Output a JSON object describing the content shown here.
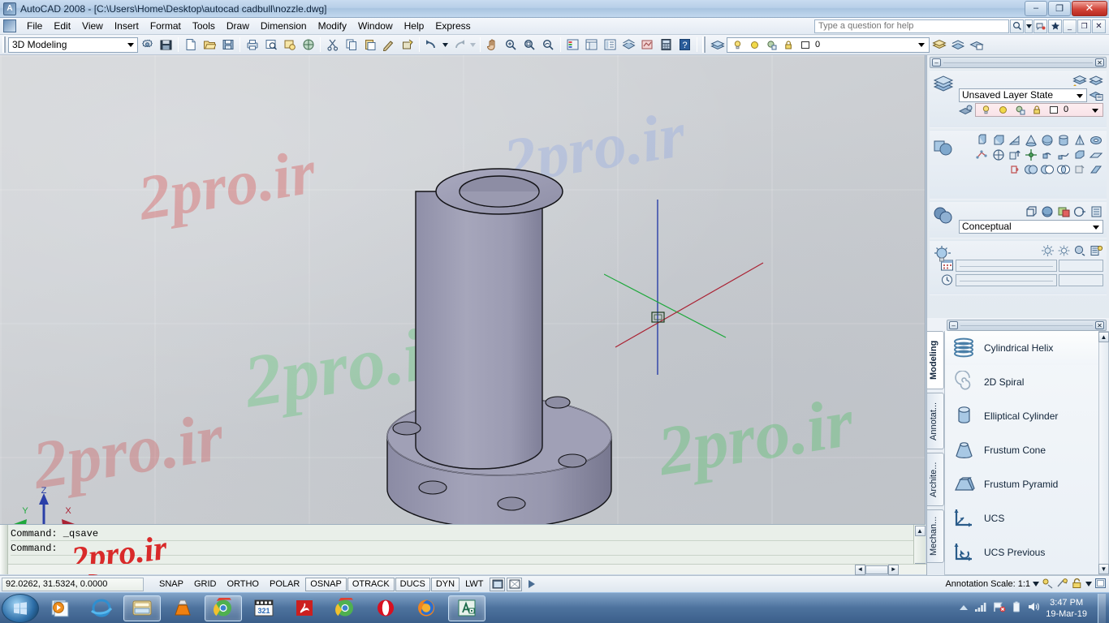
{
  "window": {
    "title": "AutoCAD 2008 - [C:\\Users\\Home\\Desktop\\autocad cadbull\\nozzle.dwg]",
    "icon": "autocad-icon",
    "minimize": "–",
    "maximize": "❐",
    "close": "✕"
  },
  "menubar": {
    "items": [
      {
        "label": "File"
      },
      {
        "label": "Edit"
      },
      {
        "label": "View"
      },
      {
        "label": "Insert"
      },
      {
        "label": "Format"
      },
      {
        "label": "Tools"
      },
      {
        "label": "Draw"
      },
      {
        "label": "Dimension"
      },
      {
        "label": "Modify"
      },
      {
        "label": "Window"
      },
      {
        "label": "Help"
      },
      {
        "label": "Express"
      }
    ],
    "help_placeholder": "Type a question for help",
    "search_icon": "magnifier-icon",
    "search_dropdown_icon": "chevron-down-icon",
    "comm_icon": "communication-center-icon",
    "fav_icon": "star-icon",
    "doc_minimize": "_",
    "doc_restore": "❐",
    "doc_close": "✕"
  },
  "toolbar": {
    "workspace": "3D Modeling",
    "workspace_settings_icon": "workspace-settings-icon",
    "workspace_save_icon": "workspace-save-icon",
    "layer_current": "0",
    "buttons": [
      "new-icon",
      "open-icon",
      "save-icon",
      "plot-icon",
      "plot-preview-icon",
      "publish-icon",
      "3dprint-icon",
      "cut-icon",
      "copy-icon",
      "paste-icon",
      "matchprop-icon",
      "blockeditor-icon",
      "undo-icon",
      "redo-icon",
      "pan-icon",
      "zoom-realtime-icon",
      "zoom-window-icon",
      "zoom-previous-icon",
      "properties-icon",
      "designcenter-icon",
      "toolpalettes-icon",
      "sheetset-icon",
      "markup-icon",
      "quickcalc-icon",
      "help-icon"
    ],
    "layer_icons": [
      "layers-icon",
      "lightbulb-icon",
      "sun-icon",
      "freeze-icon",
      "lock-icon",
      "color-swatch-icon"
    ],
    "layer_right_icons": [
      "layer-previous-icon",
      "layer-state-icon",
      "layer-properties-icon"
    ]
  },
  "canvas": {
    "ucs_labels": {
      "x": "X",
      "y": "Y",
      "z": "Z"
    },
    "model_name": "nozzle-3d-solid",
    "watermarks": [
      "2pro.ir",
      "2pro.ir",
      "2pro.ir",
      "2pro.ir",
      "2pro.ir"
    ]
  },
  "dashboard": {
    "panels": [
      {
        "name": "layers-panel",
        "big_icon": "layers-icon",
        "layer_state": "Unsaved Layer State",
        "layer_current": "0",
        "icons": [
          "layer-previous-icon",
          "layer-manager-icon",
          "layer-state-manager-icon",
          "layer-prop-icon",
          "lightbulb-icon",
          "sun-icon",
          "freeze-icon",
          "lock-icon",
          "color-swatch-icon"
        ]
      },
      {
        "name": "3d-make-panel",
        "big_icon": "3d-make-icon",
        "icons": [
          "box-icon",
          "wedge-icon",
          "pyramid-icon",
          "cone-icon",
          "sphere-icon",
          "cylinder-icon",
          "torus-icon",
          "polysolid-icon",
          "helix-icon",
          "extrude-icon",
          "revolve-icon",
          "sweep-icon",
          "loft-icon",
          "presspull-icon",
          "planarsurf-icon",
          "section-plane-icon",
          "union-icon",
          "subtract-icon",
          "intersect-icon",
          "solid-edit-icon",
          "convert-icon"
        ]
      },
      {
        "name": "visual-styles-panel",
        "big_icon": "visual-style-icon",
        "visual_style": "Conceptual",
        "icons": [
          "2d-wireframe-icon",
          "3d-hidden-icon",
          "realistic-icon",
          "xray-icon",
          "style-manager-icon"
        ]
      },
      {
        "name": "light-panel",
        "big_icon": "light-icon",
        "icons": [
          "point-light-icon",
          "spot-light-icon",
          "distant-light-icon",
          "light-list-icon"
        ],
        "sliders": [
          {
            "icon": "date-icon",
            "value": ""
          },
          {
            "icon": "time-icon",
            "value": ""
          }
        ]
      }
    ],
    "palette": {
      "tabs": [
        "Modeling",
        "Annotat...",
        "Archite...",
        "Mechan..."
      ],
      "active_tab": "Modeling",
      "items": [
        {
          "label": "Cylindrical Helix",
          "icon": "cylindrical-helix-icon"
        },
        {
          "label": "2D Spiral",
          "icon": "2d-spiral-icon"
        },
        {
          "label": "Elliptical Cylinder",
          "icon": "elliptical-cylinder-icon"
        },
        {
          "label": "Frustum Cone",
          "icon": "frustum-cone-icon"
        },
        {
          "label": "Frustum Pyramid",
          "icon": "frustum-pyramid-icon"
        },
        {
          "label": "UCS",
          "icon": "ucs-icon"
        },
        {
          "label": "UCS Previous",
          "icon": "ucs-previous-icon"
        }
      ]
    },
    "close_icon": "✕",
    "collapse_icon": "–"
  },
  "command_window": {
    "lines": [
      "Command: _qsave",
      "Command:"
    ],
    "scroll_up": "▲",
    "scroll_down": "▼"
  },
  "statusbar": {
    "coordinates": "92.0262, 31.5324, 0.0000",
    "toggles": [
      {
        "label": "SNAP",
        "active": false
      },
      {
        "label": "GRID",
        "active": false
      },
      {
        "label": "ORTHO",
        "active": false
      },
      {
        "label": "POLAR",
        "active": false
      },
      {
        "label": "OSNAP",
        "active": true
      },
      {
        "label": "OTRACK",
        "active": true
      },
      {
        "label": "DUCS",
        "active": true
      },
      {
        "label": "DYN",
        "active": true
      },
      {
        "label": "LWT",
        "active": false
      }
    ],
    "extra_icons": [
      "model-space-icon",
      "paper-space-icon",
      "quickview-icon"
    ],
    "annotation_scale_label": "Annotation Scale:",
    "annotation_scale_value": "1:1",
    "right_icons": [
      "annotation-visibility-icon",
      "autoscale-icon",
      "lock-toolbars-icon",
      "clean-screen-icon"
    ]
  },
  "taskbar": {
    "start": "start-orb-icon",
    "items": [
      {
        "icon": "media-player-icon",
        "open": false
      },
      {
        "icon": "internet-explorer-icon",
        "open": false
      },
      {
        "icon": "explorer-icon",
        "open": true
      },
      {
        "icon": "vlc-icon",
        "open": false
      },
      {
        "icon": "chrome-icon",
        "open": true
      },
      {
        "icon": "klite-codec-icon",
        "open": false
      },
      {
        "icon": "adobe-reader-icon",
        "open": false
      },
      {
        "icon": "chrome-icon-2",
        "open": false
      },
      {
        "icon": "opera-icon",
        "open": false
      },
      {
        "icon": "firefox-icon",
        "open": false
      },
      {
        "icon": "autocad-icon",
        "open": true
      }
    ],
    "tray": [
      "show-hidden-icon",
      "network-icon",
      "action-center-icon",
      "battery-icon",
      "volume-icon"
    ],
    "clock_time": "3:47 PM",
    "clock_date": "19-Mar-19"
  },
  "colors": {
    "title_blue": "#a9c4e0",
    "canvas_gray": "#cfd2d6",
    "model_body": "#9f9fb5",
    "axis_x": "#aa2233",
    "axis_y": "#1fa83c",
    "axis_z": "#2a3fa8",
    "watermark_red": "#d21f1f",
    "watermark_green": "#55cc66"
  }
}
